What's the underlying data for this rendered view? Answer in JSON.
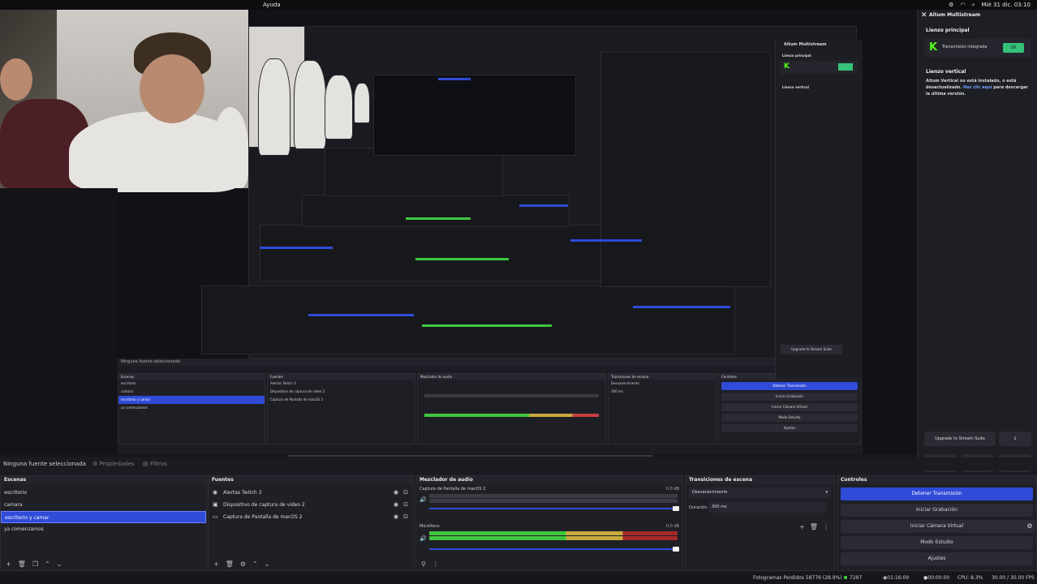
{
  "menubar": {
    "menu_item": "Ayuda",
    "datetime": "Mié 31 dic.  03:10"
  },
  "source_toolbar": {
    "no_selection": "Ninguna fuente seleccionada",
    "properties": "Propiedades",
    "filters": "Filtros"
  },
  "scenes": {
    "title": "Escenas",
    "items": [
      "escritorio",
      "camara",
      "escritorio y camar",
      "ya comenzamos"
    ],
    "selected_index": 2
  },
  "sources": {
    "title": "Fuentes",
    "items": [
      "Alertas Twitch 3",
      "Dispositivo de captura de video 2",
      "Captura de Pantalla de macOS 2"
    ]
  },
  "mixer": {
    "title": "Mezclador de audio",
    "channels": [
      {
        "name": "Captura de Pantalla de macOS 2",
        "db": "0.0 dB",
        "level": 0.0
      },
      {
        "name": "Micrófono",
        "db": "0.0 dB",
        "level": 0.72
      }
    ]
  },
  "transitions": {
    "title": "Transiciones de escena",
    "type": "Desvanecimiento",
    "duration_label": "Duración",
    "duration_value": "300 ms"
  },
  "controls": {
    "title": "Controles",
    "buttons": [
      "Detener Transmisión",
      "Iniciar Grabación",
      "Iniciar Cámara Virtual",
      "Modo Estudio",
      "Ajustes"
    ]
  },
  "status": {
    "dropped": "Fotogramas Perdidos 58776 (28.9%)",
    "bitrate": "7297 Kbps",
    "stream_time": "01:16:09",
    "rec_time": "00:00:00",
    "cpu": "CPU: 8.3%",
    "fps": "30.00 / 30.00 FPS"
  },
  "multistream": {
    "title": "Aitum Multistream",
    "main_label": "Lienzo principal",
    "main_service": "Transmisión integrada",
    "main_pill": "OK",
    "vertical_label": "Lienzo vertical",
    "vertical_msg_1": "Aitum Vertical no está instalado, o está desactualizado.",
    "vertical_link": "Haz clic aquí",
    "vertical_msg_2": "para descargar la última versión.",
    "upgrade": "Upgrade to Stream Suite",
    "upgrade_2": "1"
  },
  "colors": {
    "accent": "#2f4bd8",
    "kick_green": "#53fc18",
    "ok": "#36c27a"
  }
}
